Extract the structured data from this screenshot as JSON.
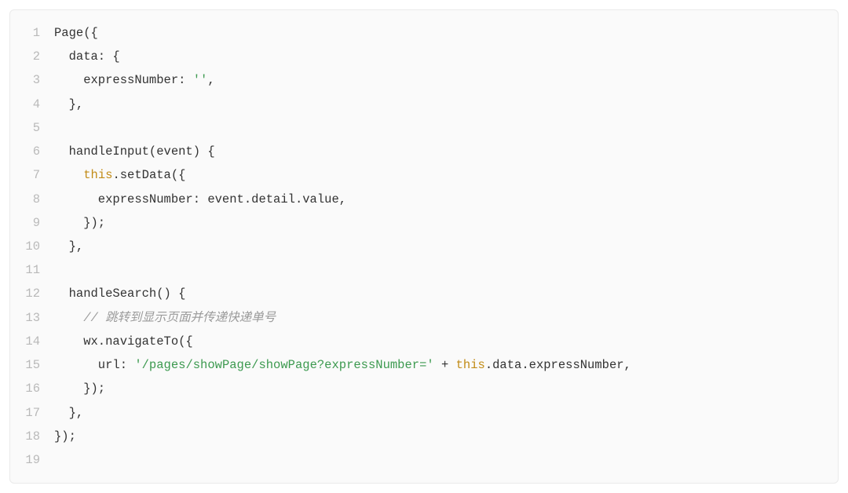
{
  "lines": [
    {
      "n": "1",
      "segs": [
        {
          "t": "Page({"
        }
      ]
    },
    {
      "n": "2",
      "segs": [
        {
          "t": "  data: {"
        }
      ]
    },
    {
      "n": "3",
      "segs": [
        {
          "t": "    expressNumber: "
        },
        {
          "t": "''",
          "cls": "string"
        },
        {
          "t": ","
        }
      ]
    },
    {
      "n": "4",
      "segs": [
        {
          "t": "  },"
        }
      ]
    },
    {
      "n": "5",
      "segs": [
        {
          "t": ""
        }
      ]
    },
    {
      "n": "6",
      "segs": [
        {
          "t": "  handleInput(event) {"
        }
      ]
    },
    {
      "n": "7",
      "segs": [
        {
          "t": "    "
        },
        {
          "t": "this",
          "cls": "keyword"
        },
        {
          "t": ".setData({"
        }
      ]
    },
    {
      "n": "8",
      "segs": [
        {
          "t": "      expressNumber: event.detail.value,"
        }
      ]
    },
    {
      "n": "9",
      "segs": [
        {
          "t": "    });"
        }
      ]
    },
    {
      "n": "10",
      "segs": [
        {
          "t": "  },"
        }
      ]
    },
    {
      "n": "11",
      "segs": [
        {
          "t": ""
        }
      ]
    },
    {
      "n": "12",
      "segs": [
        {
          "t": "  handleSearch() {"
        }
      ]
    },
    {
      "n": "13",
      "segs": [
        {
          "t": "    "
        },
        {
          "t": "// 跳转到显示页面并传递快递单号",
          "cls": "comment"
        }
      ]
    },
    {
      "n": "14",
      "segs": [
        {
          "t": "    wx.navigateTo({"
        }
      ]
    },
    {
      "n": "15",
      "segs": [
        {
          "t": "      url: "
        },
        {
          "t": "'/pages/showPage/showPage?expressNumber='",
          "cls": "string"
        },
        {
          "t": " + "
        },
        {
          "t": "this",
          "cls": "keyword"
        },
        {
          "t": ".data.expressNumber,"
        }
      ]
    },
    {
      "n": "16",
      "segs": [
        {
          "t": "    });"
        }
      ]
    },
    {
      "n": "17",
      "segs": [
        {
          "t": "  },"
        }
      ]
    },
    {
      "n": "18",
      "segs": [
        {
          "t": "});"
        }
      ]
    },
    {
      "n": "19",
      "segs": [
        {
          "t": ""
        }
      ]
    }
  ]
}
